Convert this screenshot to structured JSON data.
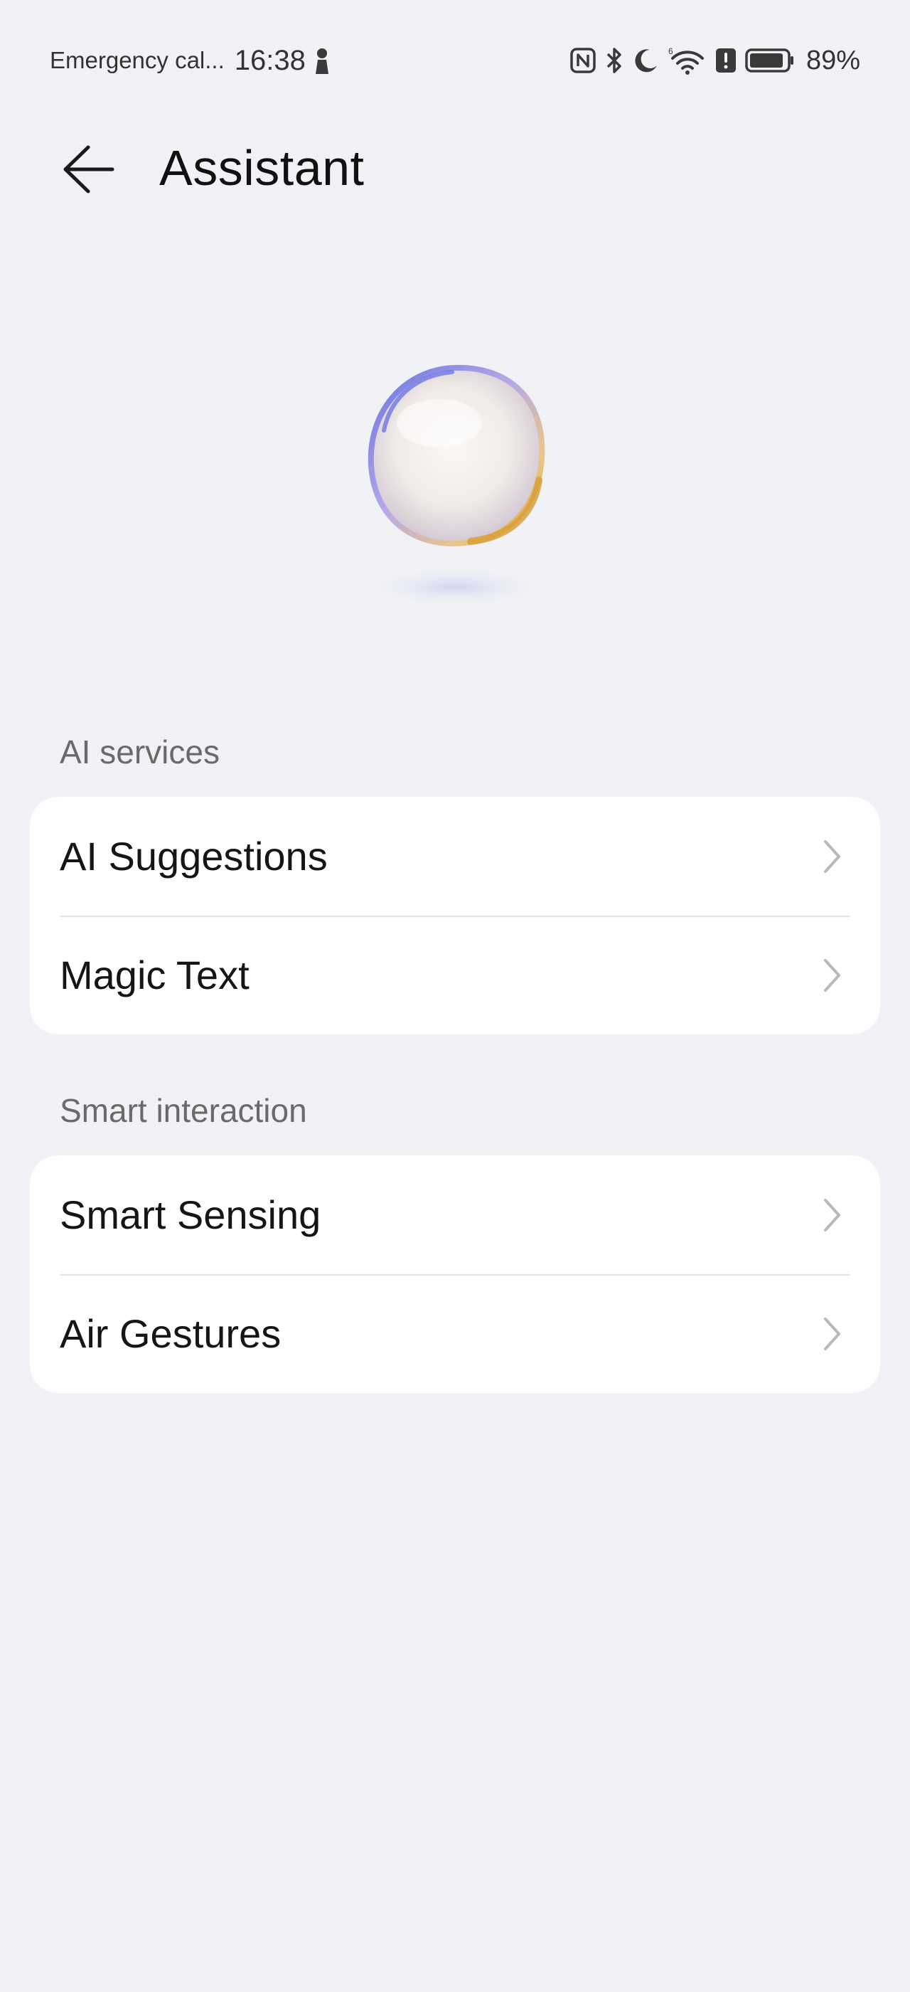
{
  "status_bar": {
    "carrier": "Emergency cal...",
    "time": "16:38",
    "battery_percent": "89%",
    "icons": [
      "person-icon",
      "nfc-icon",
      "bluetooth-icon",
      "moon-icon",
      "wifi-icon",
      "alert-icon",
      "battery-icon"
    ]
  },
  "header": {
    "back_icon": "back-arrow-icon",
    "title": "Assistant"
  },
  "hero": {
    "image": "assistant-orb-illustration"
  },
  "sections": [
    {
      "title": "AI services",
      "items": [
        {
          "label": "AI Suggestions",
          "icon": "chevron-right-icon"
        },
        {
          "label": "Magic Text",
          "icon": "chevron-right-icon"
        }
      ]
    },
    {
      "title": "Smart interaction",
      "items": [
        {
          "label": "Smart Sensing",
          "icon": "chevron-right-icon"
        },
        {
          "label": "Air Gestures",
          "icon": "chevron-right-icon"
        }
      ]
    }
  ],
  "colors": {
    "background": "#f1f2f6",
    "card": "#ffffff",
    "section_title": "#6a6a6a",
    "chevron": "#b8b8b8"
  }
}
